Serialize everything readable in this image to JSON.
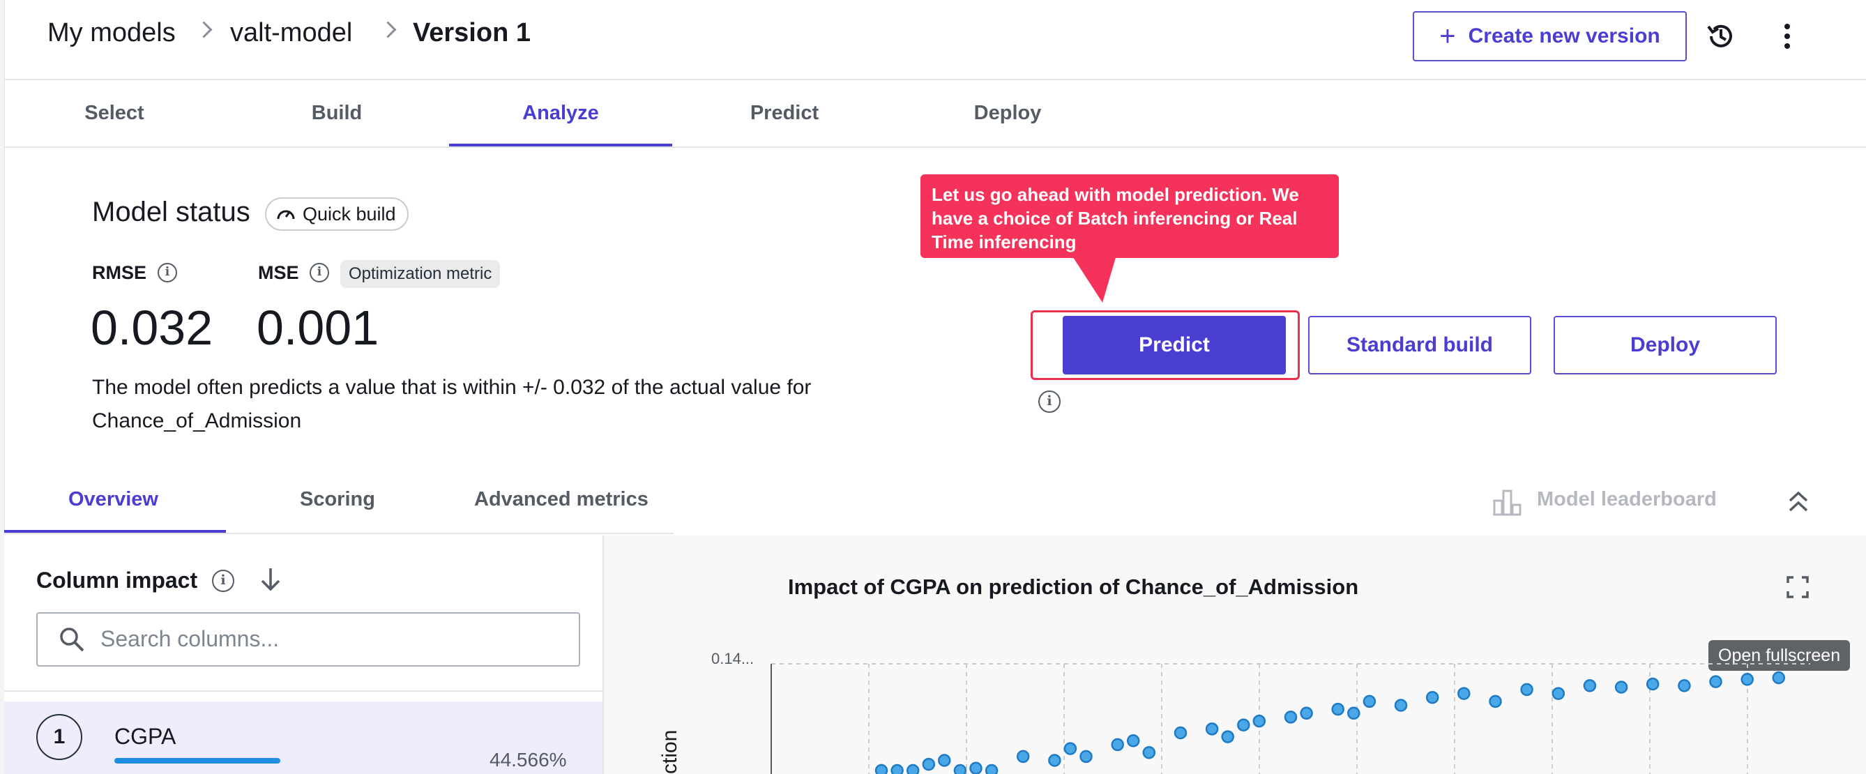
{
  "breadcrumb": {
    "root": "My models",
    "model": "valt-model",
    "version": "Version 1"
  },
  "header": {
    "create_version_label": "Create new version",
    "create_version_plus": "+"
  },
  "tabs": [
    "Select",
    "Build",
    "Analyze",
    "Predict",
    "Deploy"
  ],
  "active_tab": "Analyze",
  "model_status": {
    "title": "Model status",
    "build_chip": "Quick build",
    "metrics": [
      {
        "label": "RMSE",
        "value": "0.032"
      },
      {
        "label": "MSE",
        "value": "0.001",
        "badge": "Optimization metric"
      }
    ],
    "description": "The model often predicts a value that is within +/- 0.032 of the actual value for Chance_of_Admission"
  },
  "callout": {
    "text": "Let us go ahead with model prediction. We have a choice of Batch inferencing or Real Time inferencing"
  },
  "actions": {
    "predict_label": "Predict",
    "standard_build_label": "Standard build",
    "deploy_label": "Deploy"
  },
  "subtabs": [
    "Overview",
    "Scoring",
    "Advanced metrics"
  ],
  "active_subtab": "Overview",
  "leaderboard_label": "Model leaderboard",
  "column_impact": {
    "title": "Column impact",
    "search_placeholder": "Search columns...",
    "rows": [
      {
        "rank": "1",
        "name": "CGPA",
        "impact": "44.566%",
        "impact_fraction": 0.4457
      }
    ]
  },
  "chart": {
    "title": "Impact of CGPA on prediction of Chance_of_Admission",
    "tooltip": "Open fullscreen",
    "ylabel_partial": "ction",
    "y_top_tick": "0.14..."
  },
  "chart_data": {
    "type": "scatter",
    "title": "Impact of CGPA on prediction of Chance_of_Admission",
    "xlabel": "",
    "ylabel": "ction",
    "y_tick_labels": [
      "0.14..."
    ],
    "grid": true,
    "series": [
      {
        "values_xy": [
          [
            0.07,
            0.01
          ],
          [
            0.08,
            0.02
          ],
          [
            0.09,
            0.015
          ],
          [
            0.1,
            0.03
          ],
          [
            0.11,
            0.035
          ],
          [
            0.12,
            0.02
          ],
          [
            0.13,
            0.025
          ],
          [
            0.14,
            0.018
          ],
          [
            0.16,
            0.04
          ],
          [
            0.18,
            0.035
          ],
          [
            0.19,
            0.05
          ],
          [
            0.2,
            0.04
          ],
          [
            0.22,
            0.055
          ],
          [
            0.23,
            0.06
          ],
          [
            0.24,
            0.045
          ],
          [
            0.26,
            0.07
          ],
          [
            0.28,
            0.075
          ],
          [
            0.29,
            0.065
          ],
          [
            0.3,
            0.08
          ],
          [
            0.31,
            0.085
          ],
          [
            0.33,
            0.09
          ],
          [
            0.34,
            0.095
          ],
          [
            0.36,
            0.1
          ],
          [
            0.37,
            0.095
          ],
          [
            0.38,
            0.11
          ],
          [
            0.4,
            0.105
          ],
          [
            0.42,
            0.115
          ],
          [
            0.44,
            0.12
          ],
          [
            0.46,
            0.11
          ],
          [
            0.48,
            0.125
          ],
          [
            0.5,
            0.12
          ],
          [
            0.52,
            0.13
          ],
          [
            0.54,
            0.128
          ],
          [
            0.56,
            0.132
          ],
          [
            0.58,
            0.13
          ],
          [
            0.6,
            0.135
          ],
          [
            0.62,
            0.138
          ],
          [
            0.64,
            0.14
          ]
        ]
      }
    ],
    "color": "#4aa8e8"
  }
}
